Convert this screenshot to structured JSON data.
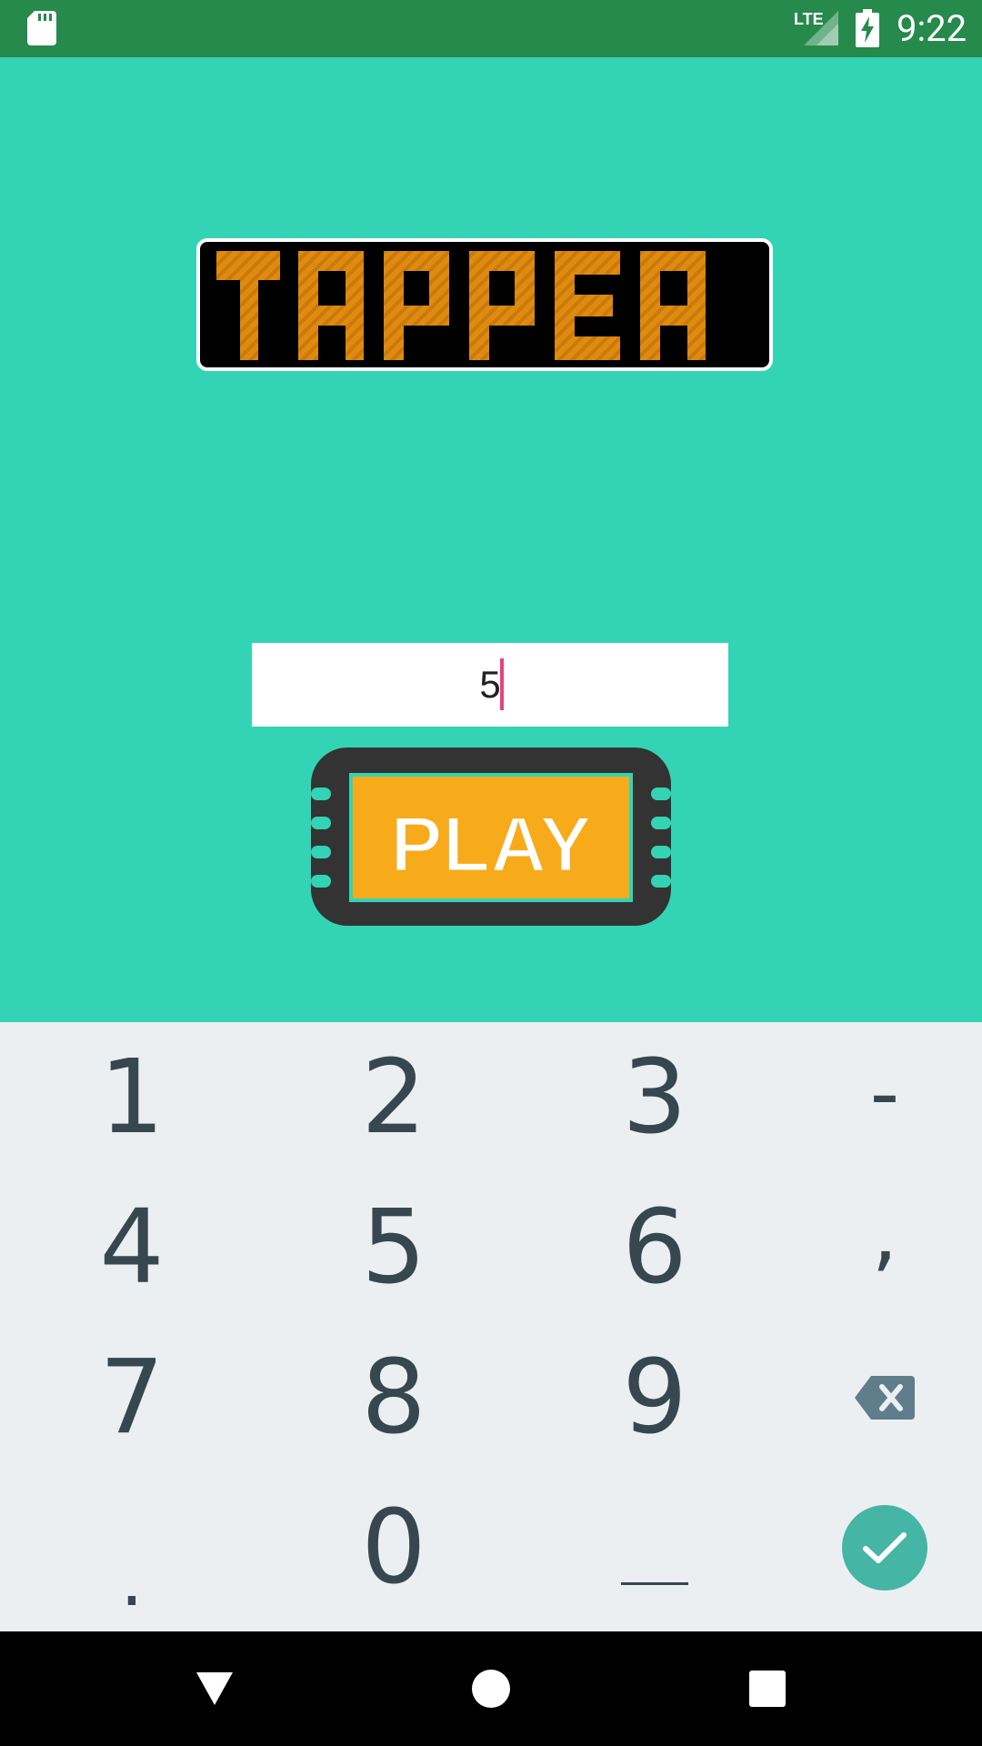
{
  "status_bar": {
    "time": "9:22",
    "network": "LTE",
    "icons": [
      "sd-card-icon",
      "signal-icon",
      "battery-charging-icon"
    ]
  },
  "app": {
    "logo_text": "TAPPER",
    "input": {
      "value": "5"
    },
    "play_label": "PLAY",
    "colors": {
      "background": "#33d4b5",
      "logo_orange": "#e08a0e",
      "play_orange": "#f7ab1b"
    }
  },
  "keyboard": {
    "rows": [
      [
        "1",
        "2",
        "3",
        "-"
      ],
      [
        "4",
        "5",
        "6",
        ","
      ],
      [
        "7",
        "8",
        "9",
        "delete"
      ],
      [
        ".",
        "0",
        "_",
        "done"
      ]
    ],
    "icons": {
      "delete": "backspace-icon",
      "done": "check-icon"
    }
  },
  "navbar": {
    "icons": [
      "back-icon",
      "home-icon",
      "recents-icon"
    ]
  }
}
